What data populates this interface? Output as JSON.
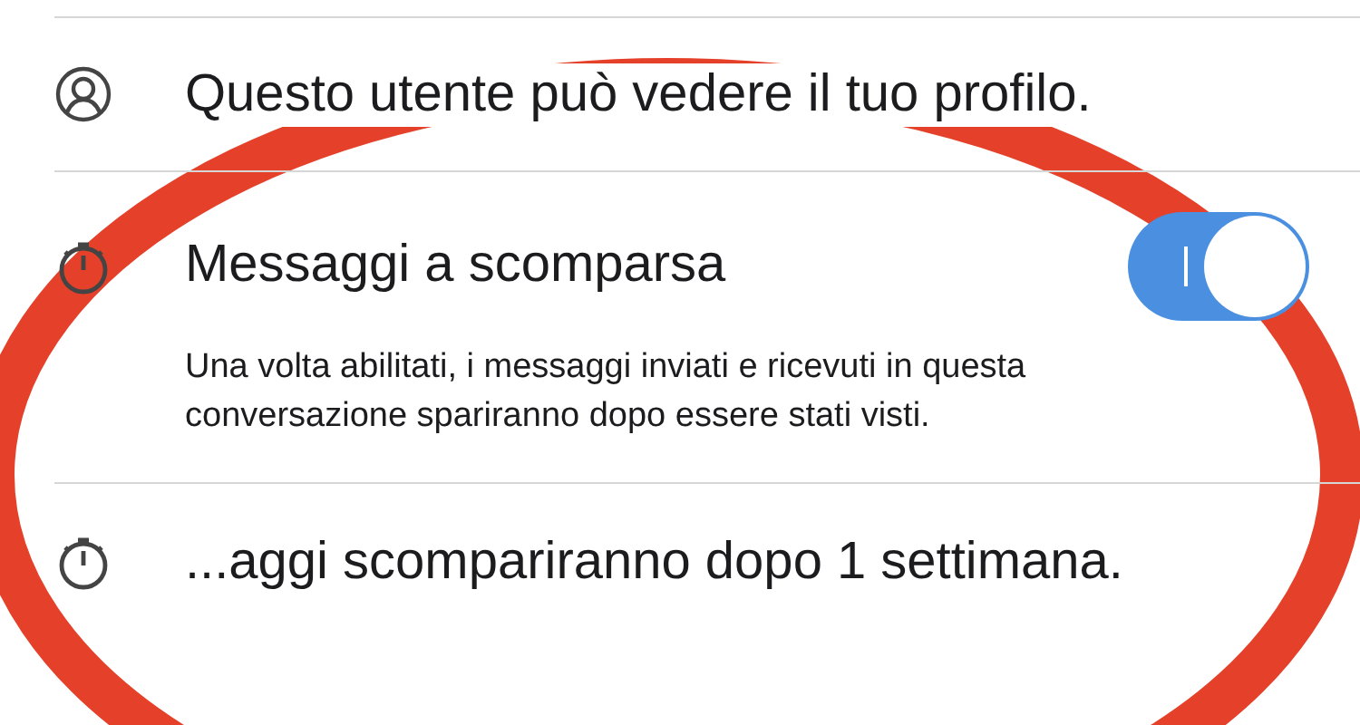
{
  "rows": [
    {
      "kind": "info",
      "title": "Questo utente può vedere il tuo profilo."
    },
    {
      "kind": "toggle",
      "title": "Messaggi a scomparsa",
      "on": true,
      "description": "Una volta abilitati, i messaggi inviati e ricevuti in questa conversazione spariranno dopo essere stati visti."
    },
    {
      "kind": "info",
      "title": "...aggi scompariranno dopo 1 settimana."
    }
  ]
}
